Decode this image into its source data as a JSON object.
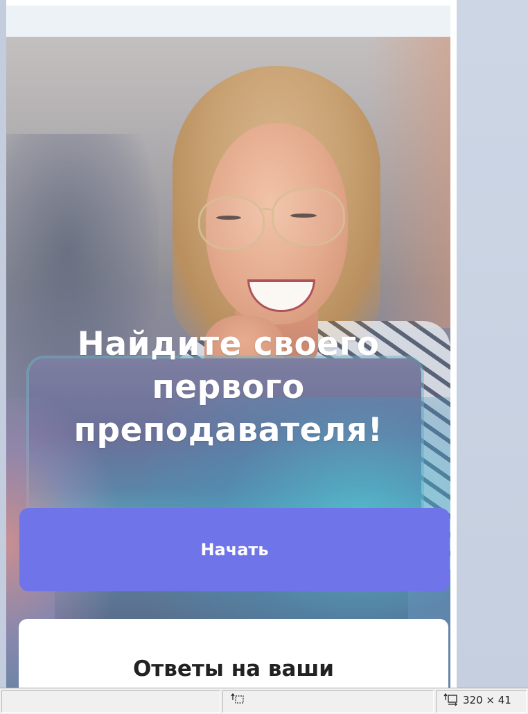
{
  "hero": {
    "headline": "Найдите своего первого преподавателя!",
    "start_button_label": "Начать"
  },
  "faq": {
    "title": "Ответы на ваши"
  },
  "statusbar": {
    "size_text": "320 × 41",
    "cursor_icon": "selection-cursor-icon",
    "size_icon": "dimensions-icon"
  },
  "colors": {
    "accent": "#6f74e8",
    "topbar": "#edf2f7",
    "card": "#ffffff"
  }
}
